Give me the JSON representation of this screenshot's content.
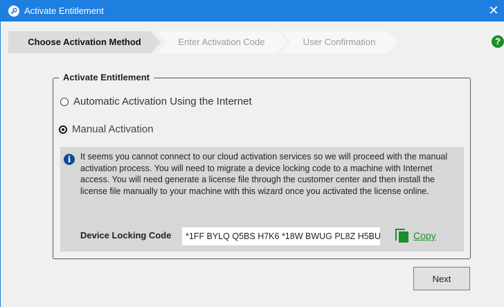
{
  "window": {
    "title": "Activate Entitlement",
    "title_icon": "key-icon",
    "close_glyph": "✕",
    "accent_color": "#1e7fe0"
  },
  "wizard_steps": [
    {
      "label": "Choose Activation Method",
      "state": "active"
    },
    {
      "label": "Enter Activation Code",
      "state": "inactive"
    },
    {
      "label": "User Confirmation",
      "state": "inactive"
    }
  ],
  "help": {
    "glyph": "?",
    "icon": "help-icon",
    "color": "#1b8e2d"
  },
  "group": {
    "legend": "Activate Entitlement",
    "options": [
      {
        "label": "Automatic Activation Using the Internet",
        "selected": false
      },
      {
        "label": "Manual Activation",
        "selected": true
      }
    ]
  },
  "info": {
    "icon": "info-icon",
    "glyph": "i",
    "message": "It seems you cannot connect to our cloud activation services so we will proceed with the manual activation process. You will need to migrate a device locking code to a machine with Internet access. You will need generate a license file through the customer center and then install the license file manually to your machine with this wizard once you activated the license online.",
    "code_label": "Device Locking Code",
    "code_value": "*1FF BYLQ Q5BS H7K6 *18W BWUG PL8Z H5BU",
    "copy_label": "Copy",
    "copy_icon": "copy-icon"
  },
  "footer": {
    "next_label": "Next"
  }
}
